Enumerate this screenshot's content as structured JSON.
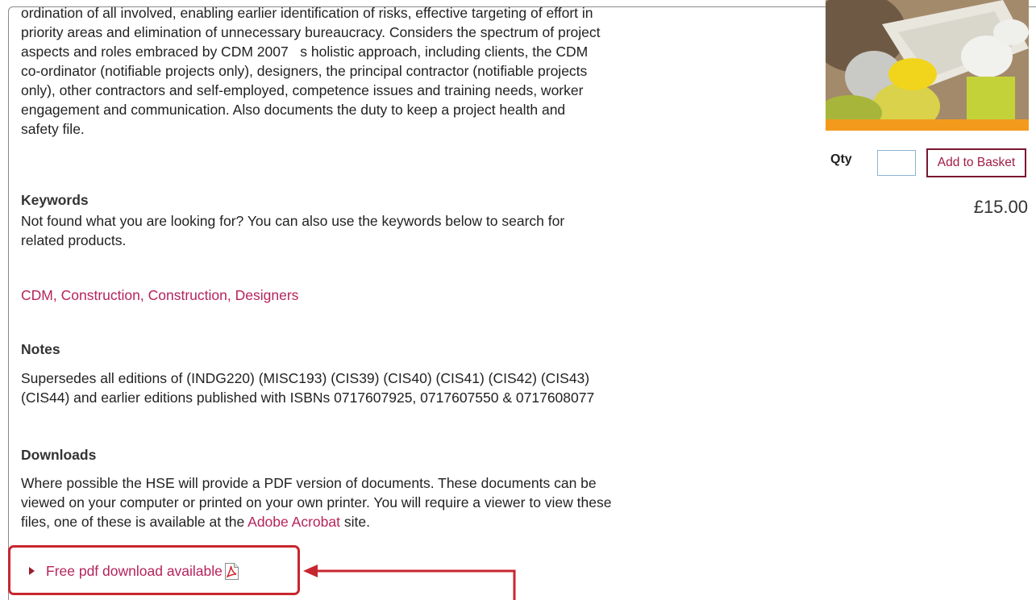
{
  "product": {
    "description": "ordination of all involved, enabling earlier identification of risks, effective targeting of effort in\npriority areas and elimination of unnecessary bureaucracy. Considers the spectrum of project\naspects and roles embraced by CDM 2007   s holistic approach, including clients, the CDM\nco-ordinator (notifiable projects only), designers, the principal contractor (notifiable projects\nonly), other contractors and self-employed, competence issues and training needs, worker\nengagement and communication. Also documents the duty to keep a project health and\nsafety file.",
    "image_icon": "construction-cover-image"
  },
  "keywords": {
    "heading": "Keywords",
    "text": "Not found what you are looking for? You can also use the keywords below to search for\nrelated products.",
    "links": [
      "CDM",
      "Construction",
      "Construction",
      "Designers"
    ],
    "separator": ","
  },
  "notes": {
    "heading": "Notes",
    "text": "Supersedes all editions of (INDG220) (MISC193) (CIS39) (CIS40) (CIS41) (CIS42) (CIS43)\n(CIS44) and earlier editions published with ISBNs 0717607925, 0717607550 & 0717608077"
  },
  "downloads": {
    "heading": "Downloads",
    "text_before_link": "Where possible the HSE will provide a PDF version of documents. These documents can be\nviewed on your computer or printed on your own printer. You will require a viewer to view these\nfiles, one of these is available at the ",
    "link": "Adobe Acrobat",
    "text_after_link": " site.",
    "pdf_link": "Free pdf download available",
    "pdf_icon": "pdf-icon"
  },
  "purchase": {
    "qty_label": "Qty",
    "qty_value": "",
    "add_button": "Add to Basket",
    "price": "£15.00"
  },
  "colors": {
    "link": "#b5235b",
    "highlight": "#c8262e"
  }
}
